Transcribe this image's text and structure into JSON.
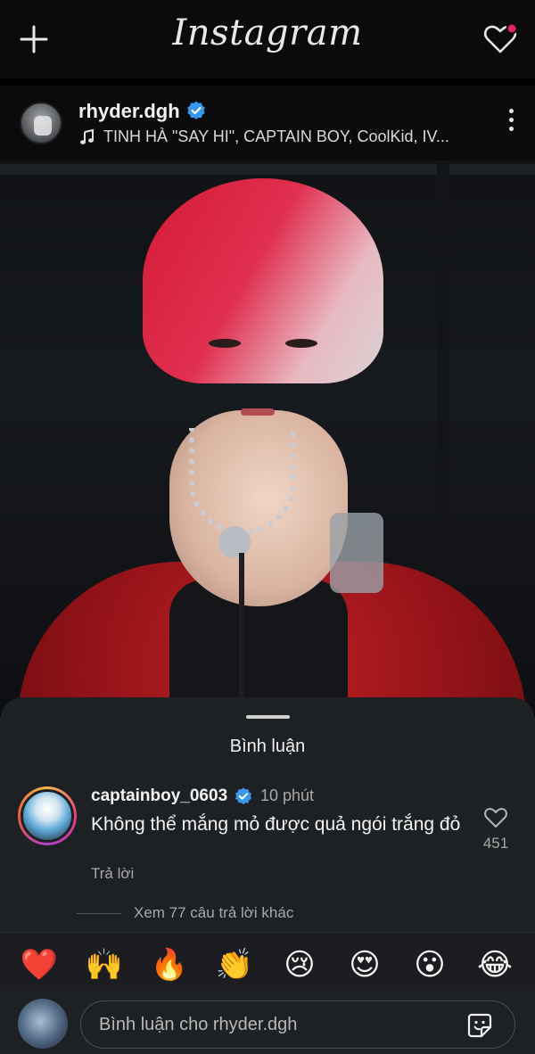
{
  "app": {
    "logo_text": "Instagram",
    "accent": "#e0245e",
    "verified_color": "#3897f0"
  },
  "topbar": {
    "new_post_icon": "plus-icon",
    "activity_icon": "heart-icon",
    "has_notification": true
  },
  "post": {
    "username": "rhyder.dgh",
    "verified": true,
    "audio": "TINH HÀ \"SAY HI\", CAPTAIN BOY, CoolKid, IV..."
  },
  "comments_sheet": {
    "title": "Bình luận",
    "comment": {
      "username": "captainboy_0603",
      "verified": true,
      "time": "10 phút",
      "text": "Không thể mắng mỏ được quả ngói trắng đỏ",
      "reply_label": "Trả lời",
      "likes": "451"
    },
    "view_more_replies": "Xem 77 câu trả lời khác",
    "emoji_reactions": [
      "❤️",
      "🙌",
      "🔥",
      "👏",
      "😢",
      "😍",
      "😮",
      "😂"
    ],
    "composer_placeholder": "Bình luận cho rhyder.dgh"
  }
}
